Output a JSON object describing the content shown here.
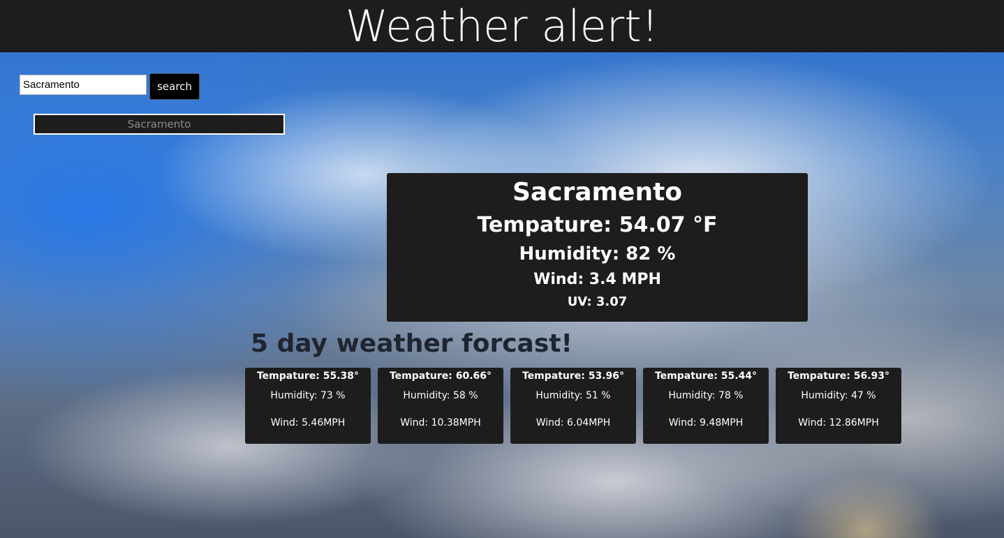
{
  "header": {
    "title": "Weather alert!"
  },
  "search": {
    "value": "Sacramento",
    "button_label": "search"
  },
  "history": {
    "items": [
      "Sacramento"
    ]
  },
  "current": {
    "city": "Sacramento",
    "temperature": "Tempature: 54.07 °F",
    "humidity": "Humidity: 82 %",
    "wind": "Wind: 3.4 MPH",
    "uv": "UV: 3.07"
  },
  "forecast": {
    "title": "5 day weather forcast!",
    "days": [
      {
        "temp": "Tempature: 55.38°",
        "humidity": "Humidity: 73 %",
        "wind": "Wind: 5.46MPH"
      },
      {
        "temp": "Tempature: 60.66°",
        "humidity": "Humidity: 58 %",
        "wind": "Wind: 10.38MPH"
      },
      {
        "temp": "Tempature: 53.96°",
        "humidity": "Humidity: 51 %",
        "wind": "Wind: 6.04MPH"
      },
      {
        "temp": "Tempature: 55.44°",
        "humidity": "Humidity: 78 %",
        "wind": "Wind: 9.48MPH"
      },
      {
        "temp": "Tempature: 56.93°",
        "humidity": "Humidity: 47 %",
        "wind": "Wind: 12.86MPH"
      }
    ]
  },
  "colors": {
    "panel": "#1d1d1d",
    "text": "#ffffff",
    "history_text": "#8c8c8c"
  }
}
